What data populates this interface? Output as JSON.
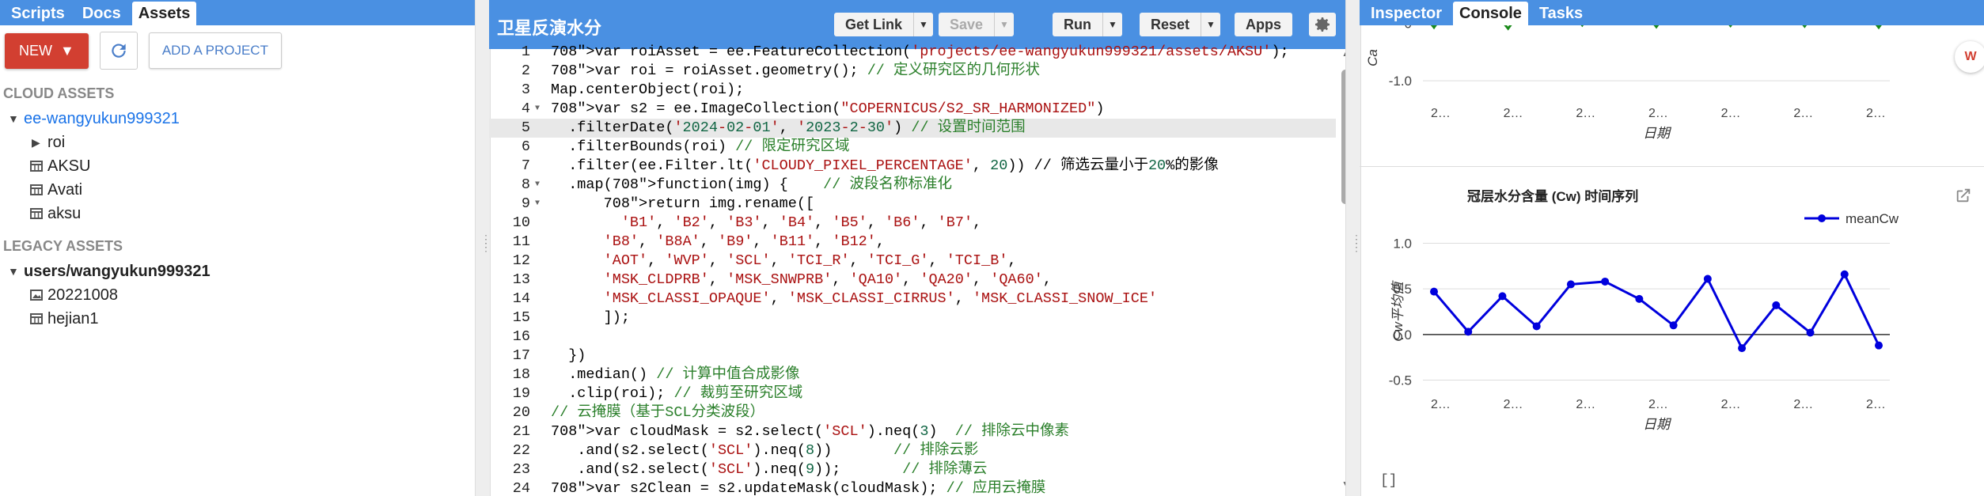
{
  "left": {
    "tabs": [
      "Scripts",
      "Docs",
      "Assets"
    ],
    "new_label": "NEW",
    "add_project_label": "ADD A PROJECT",
    "cloud_section": "CLOUD ASSETS",
    "cloud_user": "ee-wangyukun999321",
    "cloud_items": [
      "roi",
      "AKSU",
      "Avati",
      "aksu"
    ],
    "legacy_section": "LEGACY ASSETS",
    "legacy_user": "users/wangyukun999321",
    "legacy_items": [
      "20221008",
      "hejian1"
    ]
  },
  "editor": {
    "title": "卫星反演水分",
    "buttons": {
      "get_link": "Get Link",
      "save": "Save",
      "run": "Run",
      "reset": "Reset",
      "apps": "Apps"
    },
    "lines": [
      "var roiAsset = ee.FeatureCollection('projects/ee-wangyukun999321/assets/AKSU');",
      "var roi = roiAsset.geometry(); // 定义研究区的几何形状",
      "Map.centerObject(roi);",
      "var s2 = ee.ImageCollection(\"COPERNICUS/S2_SR_HARMONIZED\")",
      "  .filterDate('2024-02-01', '2023-2-30') // 设置时间范围",
      "  .filterBounds(roi) // 限定研究区域",
      "  .filter(ee.Filter.lt('CLOUDY_PIXEL_PERCENTAGE', 20)) // 筛选云量小于20%的影像",
      "  .map(function(img) {    // 波段名称标准化",
      "      return img.rename([",
      "        'B1', 'B2', 'B3', 'B4', 'B5', 'B6', 'B7',",
      "      'B8', 'B8A', 'B9', 'B11', 'B12',",
      "      'AOT', 'WVP', 'SCL', 'TCI_R', 'TCI_G', 'TCI_B',",
      "      'MSK_CLDPRB', 'MSK_SNWPRB', 'QA10', 'QA20', 'QA60',",
      "      'MSK_CLASSI_OPAQUE', 'MSK_CLASSI_CIRRUS', 'MSK_CLASSI_SNOW_ICE'",
      "      ]);",
      "",
      "  })",
      "  .median() // 计算中值合成影像",
      "  .clip(roi); // 裁剪至研究区域",
      "// 云掩膜（基于SCL分类波段）",
      "var cloudMask = s2.select('SCL').neq(3)  // 排除云中像素",
      "   .and(s2.select('SCL').neq(8))       // 排除云影",
      "   .and(s2.select('SCL').neq(9));       // 排除薄云",
      "var s2Clean = s2.updateMask(cloudMask); // 应用云掩膜"
    ]
  },
  "right": {
    "tabs": [
      "Inspector",
      "Console",
      "Tasks"
    ],
    "console_output": "[]"
  },
  "chart_data": [
    {
      "type": "line",
      "title": "",
      "xlabel": "日期",
      "ylabel": "Ca",
      "yticks": [
        0,
        -1
      ],
      "ylim": [
        -1.3,
        0.1
      ],
      "x": [
        "2…",
        "2…",
        "2…",
        "2…",
        "2…",
        "2…",
        "2…"
      ],
      "series": [
        {
          "values": [
            -0.02,
            -0.04,
            0.02,
            -0.01,
            0.01,
            0.0,
            -0.02
          ]
        }
      ],
      "grid": true
    },
    {
      "type": "line",
      "title": "冠层水分含量 (Cw) 时间序列",
      "xlabel": "日期",
      "ylabel": "Cw平均值",
      "ylim": [
        -0.6,
        1.1
      ],
      "yticks": [
        1.0,
        0.5,
        0.0,
        -0.5
      ],
      "x": [
        "2…",
        "2…",
        "2…",
        "2…",
        "2…",
        "2…",
        "2…"
      ],
      "legend": "top-right",
      "series": [
        {
          "name": "meanCw",
          "color": "#0000dd",
          "values": [
            0.47,
            0.03,
            0.42,
            0.09,
            0.55,
            0.58,
            0.39,
            0.1,
            0.61,
            -0.15,
            0.32,
            0.02,
            0.66,
            -0.12
          ]
        }
      ],
      "grid": true
    }
  ]
}
